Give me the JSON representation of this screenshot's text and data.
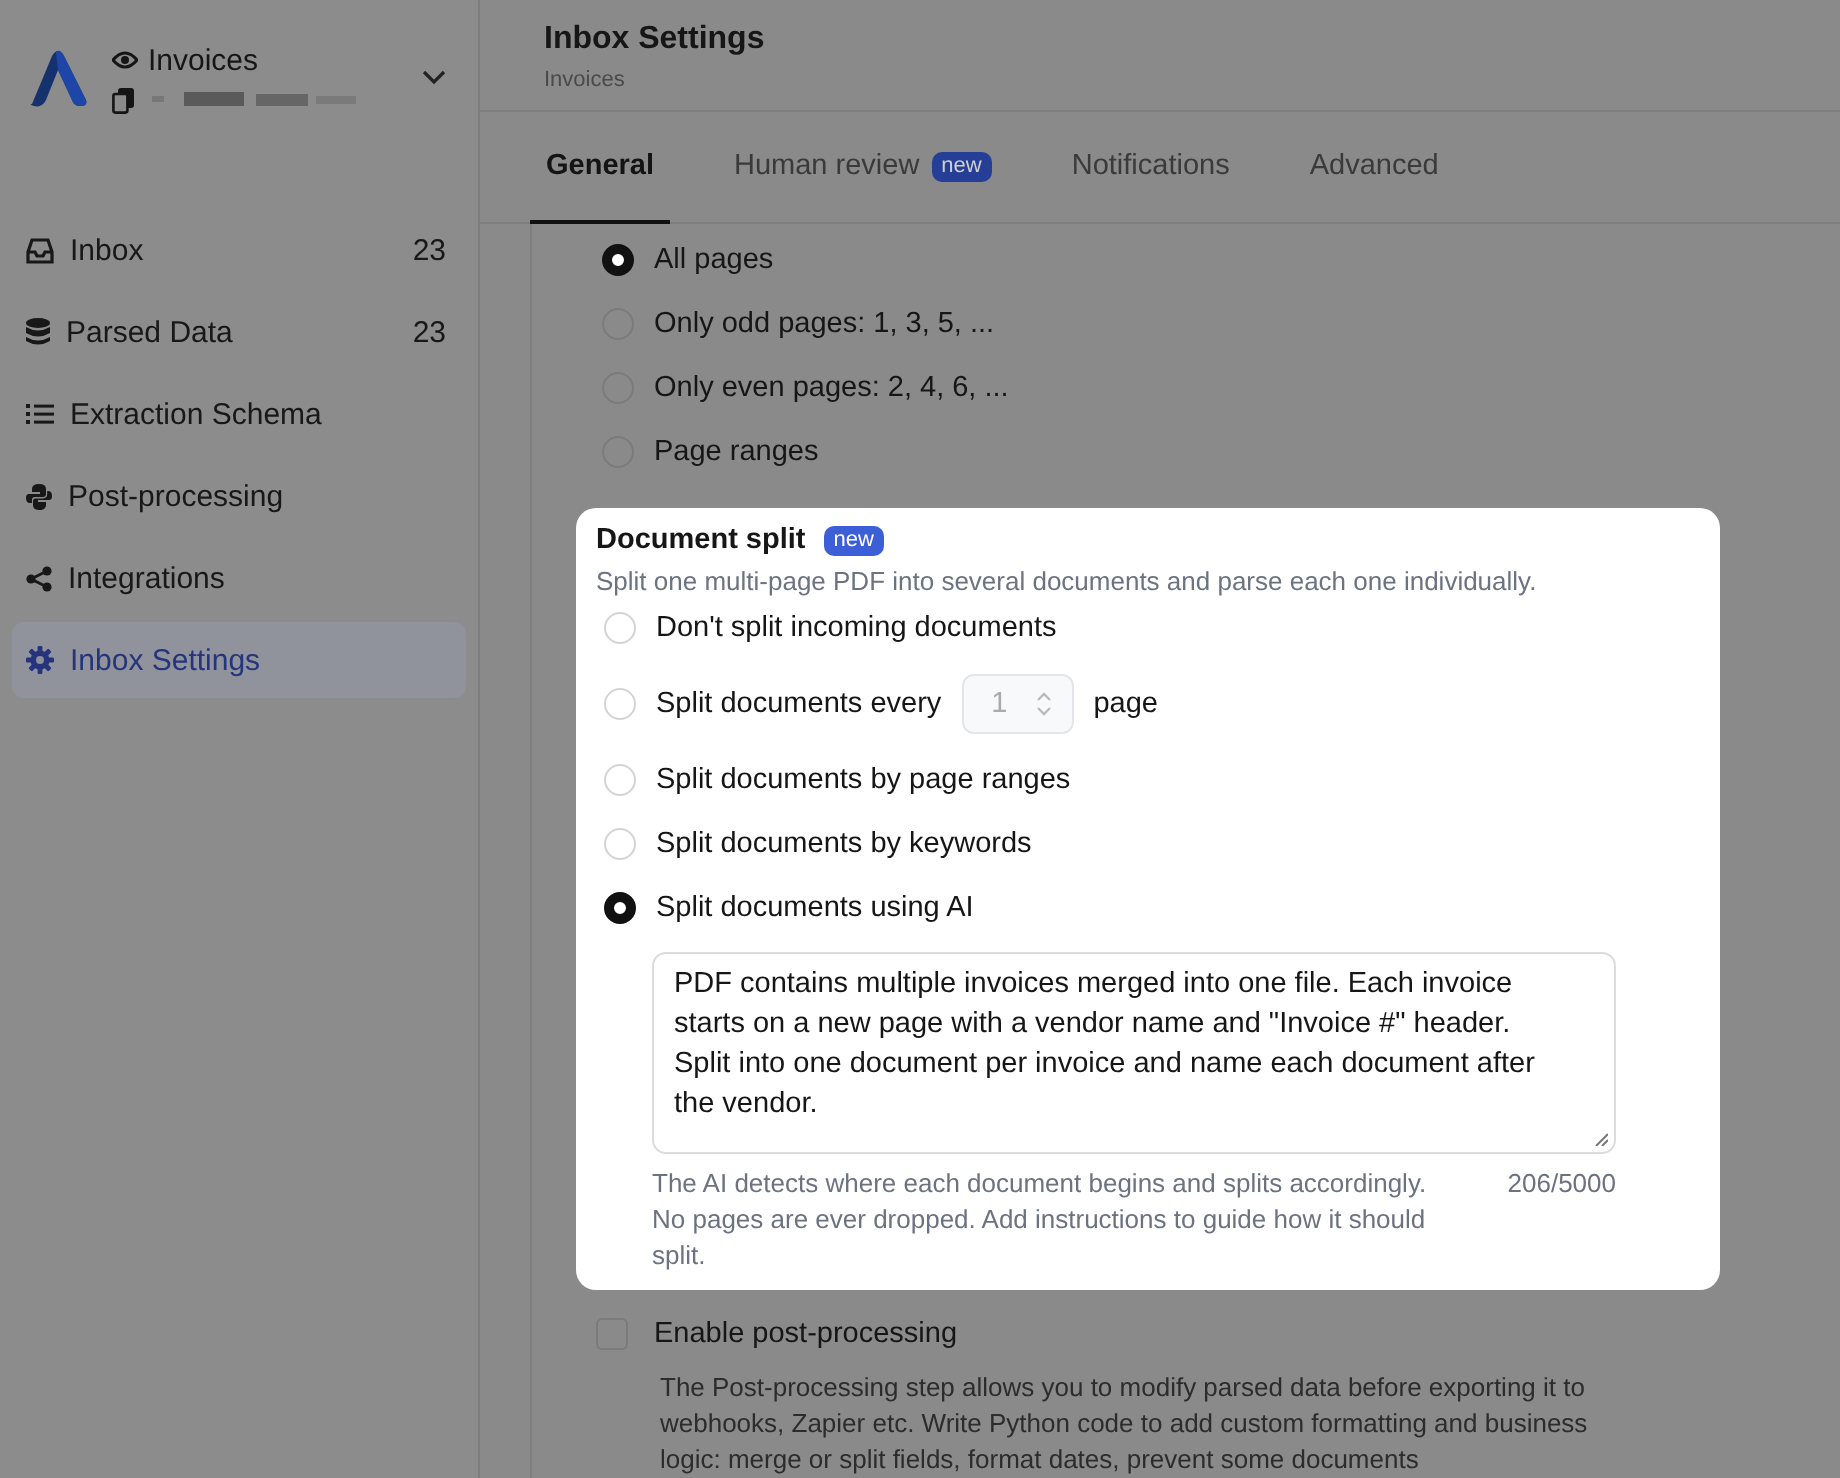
{
  "sidebar": {
    "workspace": {
      "name": "Invoices"
    },
    "items": [
      {
        "label": "Inbox",
        "count": "23",
        "selected": false
      },
      {
        "label": "Parsed Data",
        "count": "23",
        "selected": false
      },
      {
        "label": "Extraction Schema",
        "selected": false
      },
      {
        "label": "Post-processing",
        "selected": false
      },
      {
        "label": "Integrations",
        "selected": false
      },
      {
        "label": "Inbox Settings",
        "selected": true
      }
    ]
  },
  "header": {
    "title": "Inbox Settings",
    "subtitle": "Invoices"
  },
  "tabs": [
    {
      "label": "General",
      "selected": true
    },
    {
      "label": "Human review",
      "badge": "new",
      "selected": false
    },
    {
      "label": "Notifications",
      "selected": false
    },
    {
      "label": "Advanced",
      "selected": false
    }
  ],
  "page_selection": {
    "options": [
      {
        "label": "All pages",
        "selected": true
      },
      {
        "label": "Only odd pages: 1, 3, 5, ...",
        "selected": false
      },
      {
        "label": "Only even pages: 2, 4, 6, ...",
        "selected": false
      },
      {
        "label": "Page ranges",
        "selected": false
      }
    ]
  },
  "document_split": {
    "title": "Document split",
    "badge": "new",
    "description": "Split one multi-page PDF into several documents and parse each one individually.",
    "options": [
      {
        "kind": "plain",
        "label": "Don't split incoming documents",
        "selected": false
      },
      {
        "kind": "number",
        "label": "Split documents every",
        "value": "1",
        "suffix": "page",
        "selected": false
      },
      {
        "kind": "plain",
        "label": "Split documents by page ranges",
        "selected": false
      },
      {
        "kind": "plain",
        "label": "Split documents by keywords",
        "selected": false
      },
      {
        "kind": "plain",
        "label": "Split documents using AI",
        "selected": true
      }
    ],
    "instructions": {
      "value": "PDF contains multiple invoices merged into one file. Each invoice starts on a new page with a vendor name and \"Invoice #\" header. Split into one document per invoice and name each document after the vendor."
    },
    "help": "The AI detects where each document begins and splits accordingly. No pages are ever dropped. Add instructions to guide how it should split.",
    "counter": "206/5000"
  },
  "post_processing": {
    "label": "Enable post-processing",
    "checked": false,
    "description": "The Post-processing step allows you to modify parsed data before exporting it to webhooks, Zapier etc. Write Python code to add custom formatting and business logic: merge or split fields, format dates, prevent some documents"
  }
}
